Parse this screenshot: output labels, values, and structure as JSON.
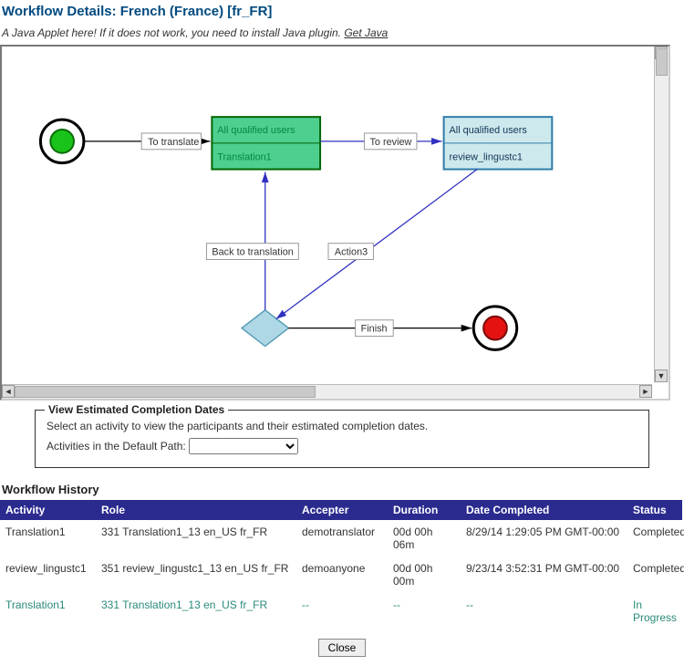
{
  "title": "Workflow Details: French (France) [fr_FR]",
  "applet": {
    "note": "A Java Applet here! If it does not work, you need to install Java plugin. ",
    "get_java": "Get Java"
  },
  "diagram": {
    "nodes": {
      "translation": {
        "line1": "All qualified users",
        "line2": "Translation1"
      },
      "review": {
        "line1": "All qualified users",
        "line2": "review_lingustc1"
      }
    },
    "edges": {
      "to_translate": "To translate",
      "to_review": "To review",
      "back_to_translation": "Back to translation",
      "action3": "Action3",
      "finish": "Finish"
    }
  },
  "estimated": {
    "legend": "View Estimated Completion Dates",
    "instruction": "Select an activity to view the participants and their estimated completion dates.",
    "label": "Activities in the Default Path:",
    "selected": ""
  },
  "history": {
    "title": "Workflow History",
    "headers": {
      "activity": "Activity",
      "role": "Role",
      "accepter": "Accepter",
      "duration": "Duration",
      "date_completed": "Date Completed",
      "status": "Status"
    },
    "rows": [
      {
        "activity": "Translation1",
        "role": "331 Translation1_13 en_US fr_FR",
        "accepter": "demotranslator",
        "duration": "00d 00h 06m",
        "date_completed": "8/29/14 1:29:05 PM GMT-00:00",
        "status": "Completed"
      },
      {
        "activity": "review_lingustc1",
        "role": "351 review_lingustc1_13 en_US fr_FR",
        "accepter": "demoanyone",
        "duration": "00d 00h 00m",
        "date_completed": "9/23/14 3:52:31 PM GMT-00:00",
        "status": "Completed"
      },
      {
        "activity": "Translation1",
        "role": "331 Translation1_13 en_US fr_FR",
        "accepter": "--",
        "duration": "--",
        "date_completed": "--",
        "status": "In Progress"
      }
    ]
  },
  "close_label": "Close"
}
